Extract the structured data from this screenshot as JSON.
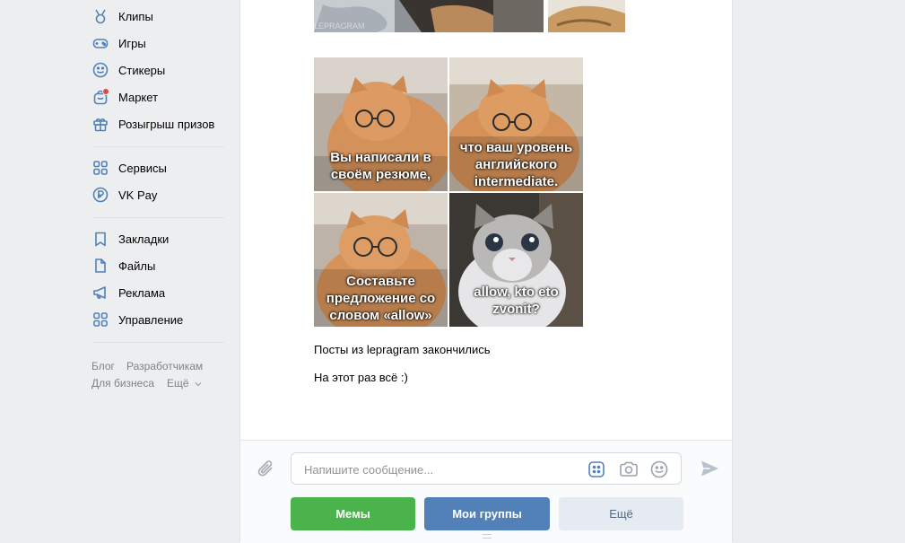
{
  "sidebar": {
    "items": [
      {
        "label": "Клипы",
        "icon": "clips-icon"
      },
      {
        "label": "Игры",
        "icon": "gamepad-icon"
      },
      {
        "label": "Стикеры",
        "icon": "smile-icon"
      },
      {
        "label": "Маркет",
        "icon": "bag-icon"
      },
      {
        "label": "Розыгрыш призов",
        "icon": "gift-icon"
      },
      {
        "label": "Сервисы",
        "icon": "services-icon"
      },
      {
        "label": "VK Pay",
        "icon": "vkpay-icon"
      },
      {
        "label": "Закладки",
        "icon": "bookmark-icon"
      },
      {
        "label": "Файлы",
        "icon": "file-icon"
      },
      {
        "label": "Реклама",
        "icon": "megaphone-icon"
      },
      {
        "label": "Управление",
        "icon": "manage-icon"
      }
    ],
    "footer": {
      "blog": "Блог",
      "developers": "Разработчикам",
      "business": "Для бизнеса",
      "more": "Ещё"
    }
  },
  "post": {
    "captions": {
      "c1": "Вы написали в своём резюме,",
      "c2": "что ваш уровень английского intermediate.",
      "c3": "Составьте предложение со словом «allow»",
      "c4": "allow, kto eto zvonit?"
    },
    "watermark": "LEPRAGRAM",
    "text1": "Посты из lepragram закончились",
    "text2": "На этот раз всё :)"
  },
  "composer": {
    "placeholder": "Напишите сообщение...",
    "buttons": {
      "memes": "Мемы",
      "groups": "Мои группы",
      "more": "Ещё"
    }
  },
  "colors": {
    "green": "#4bb34b",
    "blue": "#5181b8",
    "grey": "#e5ebf1",
    "accent": "#5181b8"
  }
}
